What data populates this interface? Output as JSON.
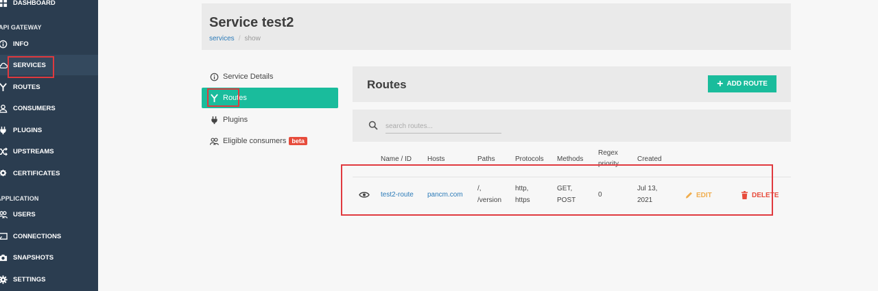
{
  "sidebar": {
    "top_item": {
      "label": "DASHBOARD"
    },
    "sections": [
      {
        "label": "API GATEWAY"
      },
      {
        "label": "APPLICATION"
      }
    ],
    "gateway_items": [
      {
        "label": "INFO",
        "icon": "info-icon"
      },
      {
        "label": "SERVICES",
        "icon": "cloud-icon"
      },
      {
        "label": "ROUTES",
        "icon": "routes-icon"
      },
      {
        "label": "CONSUMERS",
        "icon": "user-icon"
      },
      {
        "label": "PLUGINS",
        "icon": "plug-icon"
      },
      {
        "label": "UPSTREAMS",
        "icon": "shuffle-icon"
      },
      {
        "label": "CERTIFICATES",
        "icon": "certificate-icon"
      }
    ],
    "app_items": [
      {
        "label": "USERS",
        "icon": "users-icon"
      },
      {
        "label": "CONNECTIONS",
        "icon": "connections-icon"
      },
      {
        "label": "SNAPSHOTS",
        "icon": "camera-icon"
      },
      {
        "label": "SETTINGS",
        "icon": "gear-icon"
      }
    ]
  },
  "header": {
    "title": "Service test2",
    "breadcrumb": {
      "link": "services",
      "separator": "/",
      "current": "show"
    }
  },
  "left_nav": {
    "items": [
      {
        "label": "Service Details",
        "icon": "info-icon"
      },
      {
        "label": "Routes",
        "icon": "routes-icon"
      },
      {
        "label": "Plugins",
        "icon": "plug-icon"
      },
      {
        "label": "Eligible consumers",
        "icon": "users-icon",
        "badge": "beta"
      }
    ]
  },
  "routes": {
    "title": "Routes",
    "add_button": "ADD ROUTE",
    "search_placeholder": "search routes...",
    "columns": [
      "Name / ID",
      "Hosts",
      "Paths",
      "Protocols",
      "Methods",
      "Regex priority",
      "Created"
    ],
    "rows": [
      {
        "name": "test2-route",
        "hosts": "pancm.com",
        "paths": [
          "/,",
          "/version"
        ],
        "protocols": [
          "http,",
          "https"
        ],
        "methods": [
          "GET,",
          "POST"
        ],
        "regex_priority": "0",
        "created": [
          "Jul 13,",
          "2021"
        ],
        "edit_label": "EDIT",
        "delete_label": "DELETE"
      }
    ]
  },
  "colors": {
    "sidebar_bg": "#2b3d50",
    "accent": "#1abc9c",
    "danger": "#e74c3c",
    "warning": "#f0ad4e",
    "link": "#2a7ab8",
    "annotation": "#e0393e"
  }
}
